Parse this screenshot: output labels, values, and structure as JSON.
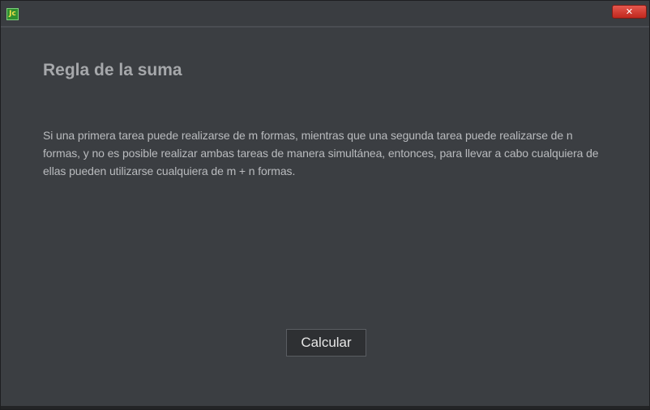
{
  "window": {
    "app_icon_text": "Jc",
    "close_symbol": "✕"
  },
  "main": {
    "heading": "Regla de la suma",
    "description": "Si una primera tarea puede realizarse de m formas, mientras que una segunda tarea puede realizarse de n formas, y no es posible realizar ambas tareas de manera simultánea, entonces, para llevar a cabo cualquiera de ellas pueden utilizarse cualquiera de m + n formas.",
    "calculate_label": "Calcular"
  },
  "colors": {
    "background": "#3b3e42",
    "heading": "#a6a8ab",
    "text": "#b9bbbe",
    "close_button": "#c0281e"
  }
}
